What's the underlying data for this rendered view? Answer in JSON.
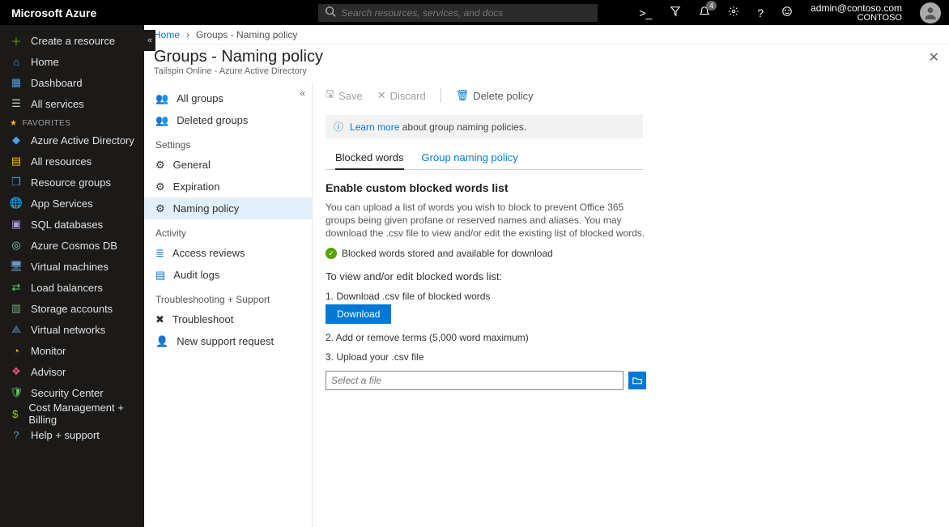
{
  "topbar": {
    "brand": "Microsoft Azure",
    "search_placeholder": "Search resources, services, and docs",
    "notification_count": "4",
    "account_email": "admin@contoso.com",
    "account_tenant": "CONTOSO"
  },
  "leftnav": {
    "create": "Create a resource",
    "home": "Home",
    "dashboard": "Dashboard",
    "allservices": "All services",
    "fav_label": "FAVORITES",
    "items": [
      "Azure Active Directory",
      "All resources",
      "Resource groups",
      "App Services",
      "SQL databases",
      "Azure Cosmos DB",
      "Virtual machines",
      "Load balancers",
      "Storage accounts",
      "Virtual networks",
      "Monitor",
      "Advisor",
      "Security Center",
      "Cost Management + Billing",
      "Help + support"
    ]
  },
  "breadcrumb": {
    "home": "Home",
    "current": "Groups - Naming policy"
  },
  "page": {
    "title": "Groups - Naming policy",
    "subtitle": "Tailspin Online - Azure Active Directory"
  },
  "subnav": {
    "allgroups": "All groups",
    "deletedgroups": "Deleted groups",
    "settings_hdr": "Settings",
    "general": "General",
    "expiration": "Expiration",
    "namingpolicy": "Naming policy",
    "activity_hdr": "Activity",
    "accessreviews": "Access reviews",
    "auditlogs": "Audit logs",
    "trouble_hdr": "Troubleshooting + Support",
    "troubleshoot": "Troubleshoot",
    "newsupport": "New support request"
  },
  "cmdbar": {
    "save": "Save",
    "discard": "Discard",
    "delete": "Delete policy"
  },
  "banner": {
    "learn": "Learn more",
    "text": " about group naming policies."
  },
  "tabs": {
    "blocked": "Blocked words",
    "groupnaming": "Group naming policy"
  },
  "content": {
    "heading": "Enable custom blocked words list",
    "desc": "You can upload a list of words you wish to block to prevent Office 365 groups being given profane or reserved names and aliases. You may download the .csv file to view and/or edit the existing list of blocked words.",
    "status": "Blocked words stored and available for download",
    "steps_title": "To view and/or edit blocked words list:",
    "step1": "1. Download .csv file of blocked words",
    "download_btn": "Download",
    "step2": "2. Add or remove terms (5,000 word maximum)",
    "step3": "3. Upload your .csv file",
    "file_placeholder": "Select a file"
  }
}
